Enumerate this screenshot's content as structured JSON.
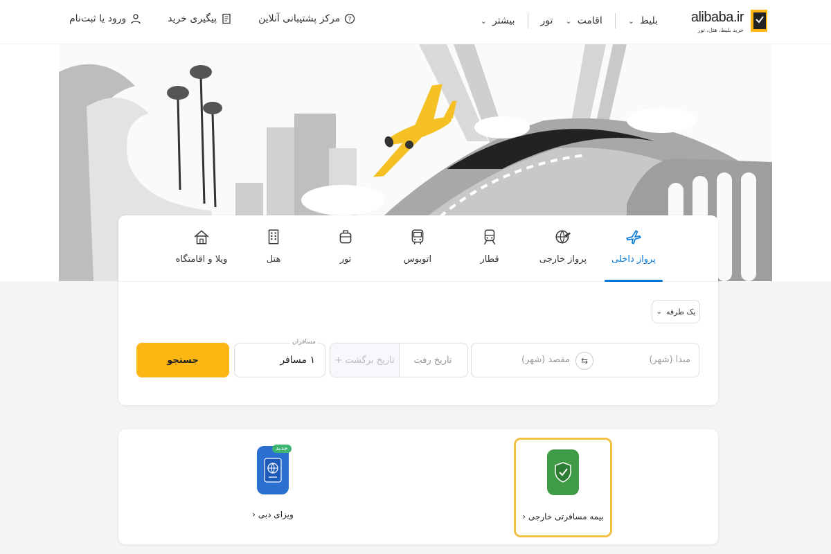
{
  "header": {
    "brand": "alibaba.ir",
    "tagline": "خرید بلیط، هتل، تور",
    "nav": [
      {
        "label": "بلیط",
        "icon": "chevron-down-icon"
      },
      {
        "label": "اقامت",
        "icon": "chevron-down-icon"
      },
      {
        "label": "تور",
        "icon": ""
      },
      {
        "label": "بیشتر",
        "icon": "chevron-down-icon"
      }
    ],
    "actions": {
      "support": "مرکز پشتیبانی آنلاین",
      "tracking": "پیگیری خرید",
      "login": "ورود یا ثبت‌نام"
    }
  },
  "tabs": [
    {
      "label": "پرواز داخلی",
      "icon": "plane-icon",
      "active": true
    },
    {
      "label": "پرواز خارجی",
      "icon": "globe-plane-icon",
      "active": false
    },
    {
      "label": "قطار",
      "icon": "train-icon",
      "active": false
    },
    {
      "label": "اتوبوس",
      "icon": "bus-icon",
      "active": false
    },
    {
      "label": "تور",
      "icon": "suitcase-icon",
      "active": false
    },
    {
      "label": "هتل",
      "icon": "hotel-icon",
      "active": false
    },
    {
      "label": "ویلا و اقامتگاه",
      "icon": "house-icon",
      "active": false
    }
  ],
  "search": {
    "trip_type": "یک طرفه",
    "origin_placeholder": "مبدا (شهر)",
    "destination_placeholder": "مقصد (شهر)",
    "depart_placeholder": "تاریخ رفت",
    "return_placeholder": "تاریخ برگشت",
    "return_add": "+",
    "passengers_label": "مسافران",
    "passengers_value": "۱ مسافر",
    "button": "جستجو"
  },
  "services": {
    "insurance": {
      "label": "بیمه مسافرتی خارجی ‹",
      "icon": "shield-check-icon"
    },
    "visa": {
      "label": "ویزای دبی ‹",
      "icon": "passport-icon",
      "badge": "جدید"
    }
  },
  "colors": {
    "accent": "#0077db",
    "search_button": "#fdb713",
    "insurance_bg": "#3f9b46",
    "visa_bg": "#2b6fd1",
    "highlight_border": "#f2c042"
  }
}
